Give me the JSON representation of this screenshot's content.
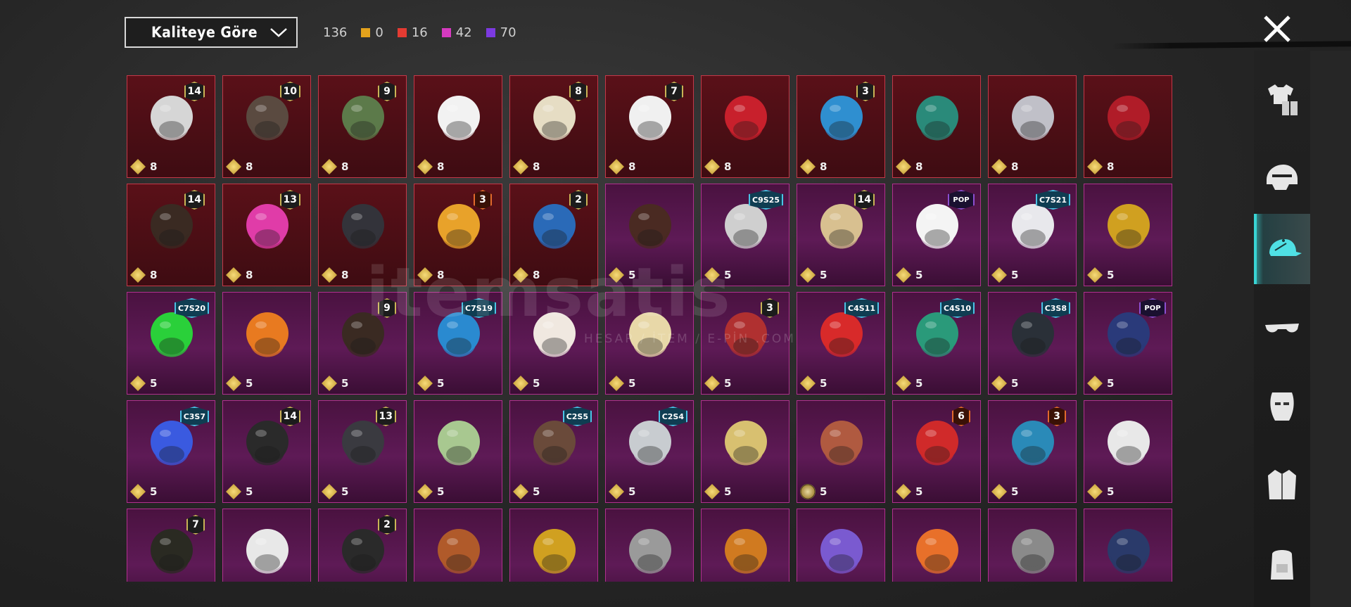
{
  "toolbar": {
    "sort_label": "Kaliteye Göre",
    "total_count": "136",
    "counts": [
      {
        "color": "#e3a21c",
        "value": "0"
      },
      {
        "color": "#e43b32",
        "value": "16"
      },
      {
        "color": "#d63ac0",
        "value": "42"
      },
      {
        "color": "#7c3ae0",
        "value": "70"
      }
    ]
  },
  "sidebar": {
    "tabs": [
      {
        "icon": "outfit-icon",
        "active": false
      },
      {
        "icon": "helmet-icon",
        "active": false
      },
      {
        "icon": "cap-icon",
        "active": true
      },
      {
        "icon": "sunglasses-icon",
        "active": false
      },
      {
        "icon": "mask-icon",
        "active": false
      },
      {
        "icon": "jacket-icon",
        "active": false
      },
      {
        "icon": "backpack-icon",
        "active": false
      }
    ]
  },
  "watermark": {
    "main": "itemsatis",
    "sub": "HESAP / İTEM / E-PİN .COM"
  },
  "items": [
    {
      "tier": "red",
      "badge": "14",
      "count": "8",
      "art": "#d6d6d6"
    },
    {
      "tier": "red",
      "badge": "10",
      "count": "8",
      "art": "#5a4a40"
    },
    {
      "tier": "red",
      "badge": "9",
      "count": "8",
      "art": "#5c7a4a"
    },
    {
      "tier": "red",
      "badge": "",
      "count": "8",
      "art": "#f2f2f2"
    },
    {
      "tier": "red",
      "badge": "8",
      "count": "8",
      "art": "#e6ddc4"
    },
    {
      "tier": "red",
      "badge": "7",
      "count": "8",
      "art": "#f0f0f0"
    },
    {
      "tier": "red",
      "badge": "",
      "count": "8",
      "art": "#c8202c"
    },
    {
      "tier": "red",
      "badge": "3",
      "count": "8",
      "art": "#2f8fd0"
    },
    {
      "tier": "red",
      "badge": "",
      "count": "8",
      "art": "#2a8a7a"
    },
    {
      "tier": "red",
      "badge": "",
      "count": "8",
      "art": "#c0c0c8"
    },
    {
      "tier": "red",
      "badge": "",
      "count": "8",
      "art": "#b01c28"
    },
    {
      "tier": "red",
      "badge": "14",
      "count": "8",
      "art": "#3a2a22"
    },
    {
      "tier": "red",
      "badge": "13",
      "count": "8",
      "art": "#e03ca8"
    },
    {
      "tier": "red",
      "badge": "",
      "count": "8",
      "art": "#33333a"
    },
    {
      "tier": "red",
      "badge": "3",
      "badge_style": "orange",
      "count": "8",
      "art": "#e8a22a"
    },
    {
      "tier": "red",
      "badge": "2",
      "count": "8",
      "art": "#2a6ab8"
    },
    {
      "tier": "purple",
      "badge": "",
      "count": "5",
      "art": "#4a2a22"
    },
    {
      "tier": "purple",
      "badge": "C9S25",
      "badge_style": "season",
      "count": "5",
      "art": "#cfcfcf"
    },
    {
      "tier": "purple",
      "badge": "14",
      "count": "5",
      "art": "#d8c090"
    },
    {
      "tier": "purple",
      "badge": "POP",
      "badge_style": "pop",
      "count": "5",
      "art": "#f4f4f4"
    },
    {
      "tier": "purple",
      "badge": "C7S21",
      "badge_style": "season",
      "count": "5",
      "art": "#e8e8ec"
    },
    {
      "tier": "purple",
      "badge": "",
      "count": "5",
      "art": "#d0a020"
    },
    {
      "tier": "purple",
      "badge": "C7S20",
      "badge_style": "season",
      "count": "5",
      "art": "#2ad03a"
    },
    {
      "tier": "purple",
      "badge": "",
      "count": "5",
      "art": "#e87a20"
    },
    {
      "tier": "purple",
      "badge": "9",
      "count": "5",
      "art": "#3a2a22"
    },
    {
      "tier": "purple",
      "badge": "C7S19",
      "badge_style": "season",
      "count": "5",
      "art": "#2a8ad0"
    },
    {
      "tier": "purple",
      "badge": "",
      "count": "5",
      "art": "#f0e8e0"
    },
    {
      "tier": "purple",
      "badge": "",
      "count": "5",
      "art": "#e8d8a8"
    },
    {
      "tier": "purple",
      "badge": "3",
      "count": "5",
      "art": "#b03030"
    },
    {
      "tier": "purple",
      "badge": "C4S11",
      "badge_style": "season",
      "count": "5",
      "art": "#d82a2a"
    },
    {
      "tier": "purple",
      "badge": "C4S10",
      "badge_style": "season",
      "count": "5",
      "art": "#2a9a7a"
    },
    {
      "tier": "purple",
      "badge": "C3S8",
      "badge_style": "season",
      "count": "5",
      "art": "#2a3038"
    },
    {
      "tier": "purple",
      "badge": "POP",
      "badge_style": "pop",
      "count": "5",
      "art": "#2a3a7a"
    },
    {
      "tier": "purple",
      "badge": "C3S7",
      "badge_style": "season",
      "count": "5",
      "art": "#3a5ae0"
    },
    {
      "tier": "purple",
      "badge": "14",
      "count": "5",
      "art": "#2a2a2a"
    },
    {
      "tier": "purple",
      "badge": "13",
      "count": "5",
      "art": "#3a3a40"
    },
    {
      "tier": "purple",
      "badge": "",
      "count": "5",
      "art": "#a8c890"
    },
    {
      "tier": "purple",
      "badge": "C2S5",
      "badge_style": "season",
      "count": "5",
      "art": "#6a4a3a"
    },
    {
      "tier": "purple",
      "badge": "C2S4",
      "badge_style": "season",
      "count": "5",
      "art": "#c8ccd0"
    },
    {
      "tier": "purple",
      "badge": "",
      "count": "5",
      "art": "#d8c070"
    },
    {
      "tier": "purple",
      "badge": "",
      "count": "5",
      "round_coin": true,
      "art": "#b05a40"
    },
    {
      "tier": "purple",
      "badge": "6",
      "badge_style": "orange",
      "count": "5",
      "art": "#d02a2a"
    },
    {
      "tier": "purple",
      "badge": "3",
      "badge_style": "orange",
      "count": "5",
      "art": "#2a8ab8"
    },
    {
      "tier": "purple",
      "badge": "",
      "count": "5",
      "art": "#e8e8e8"
    },
    {
      "tier": "purple",
      "badge": "7",
      "count": "",
      "art": "#2a2a22"
    },
    {
      "tier": "purple",
      "badge": "",
      "count": "",
      "art": "#e8e8e8"
    },
    {
      "tier": "purple",
      "badge": "2",
      "count": "",
      "art": "#2a2a2a"
    },
    {
      "tier": "purple",
      "badge": "",
      "count": "",
      "art": "#b05a2a"
    },
    {
      "tier": "purple",
      "badge": "",
      "count": "",
      "art": "#d0a020"
    },
    {
      "tier": "purple",
      "badge": "",
      "count": "",
      "art": "#9a9a9a"
    },
    {
      "tier": "purple",
      "badge": "",
      "count": "",
      "art": "#d07a20"
    },
    {
      "tier": "purple",
      "badge": "",
      "count": "",
      "art": "#7a5ad0"
    },
    {
      "tier": "purple",
      "badge": "",
      "count": "",
      "art": "#e8702a"
    },
    {
      "tier": "purple",
      "badge": "",
      "count": "",
      "art": "#8a8a8a"
    },
    {
      "tier": "purple",
      "badge": "",
      "count": "",
      "art": "#2a3a6a"
    }
  ]
}
